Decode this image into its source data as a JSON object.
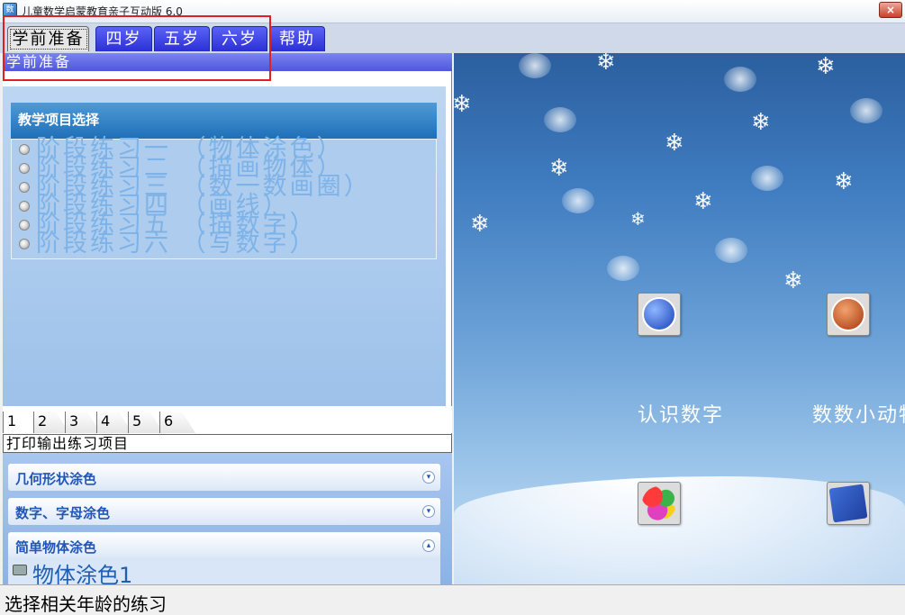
{
  "window": {
    "title": "儿童数学启蒙教育亲子互动版  6.0",
    "close_label": "×"
  },
  "tabs": [
    {
      "label": "学前准备",
      "active": true
    },
    {
      "label": "四岁"
    },
    {
      "label": "五岁"
    },
    {
      "label": "六岁"
    },
    {
      "label": "帮助"
    }
  ],
  "section_title": "学前准备",
  "project": {
    "header": "教学项目选择",
    "items": [
      "阶段练习一 （物体涂色）",
      "阶段练习二 （描画物体）",
      "阶段练习三 （数一数画圈）",
      "阶段练习四 （画线）",
      "阶段练习五 （描数字）",
      "阶段练习六 （写数字）"
    ]
  },
  "num_tabs": [
    "1",
    "2",
    "3",
    "4",
    "5",
    "6"
  ],
  "print_section": {
    "header": "打印输出练习项目",
    "groups": [
      {
        "label": "几何形状涂色",
        "state": "collapsed"
      },
      {
        "label": "数字、字母涂色",
        "state": "collapsed"
      },
      {
        "label": "简单物体涂色",
        "state": "expanded"
      }
    ],
    "expanded_item": "物体涂色1"
  },
  "apps": [
    {
      "label": "认识数字",
      "icon": "ear-sound-icon"
    },
    {
      "label": "数数小动物",
      "icon": "animal-icon"
    },
    {
      "icon": "color-balls-icon"
    },
    {
      "icon": "drawing-tools-icon"
    }
  ],
  "status": "选择相关年龄的练习"
}
